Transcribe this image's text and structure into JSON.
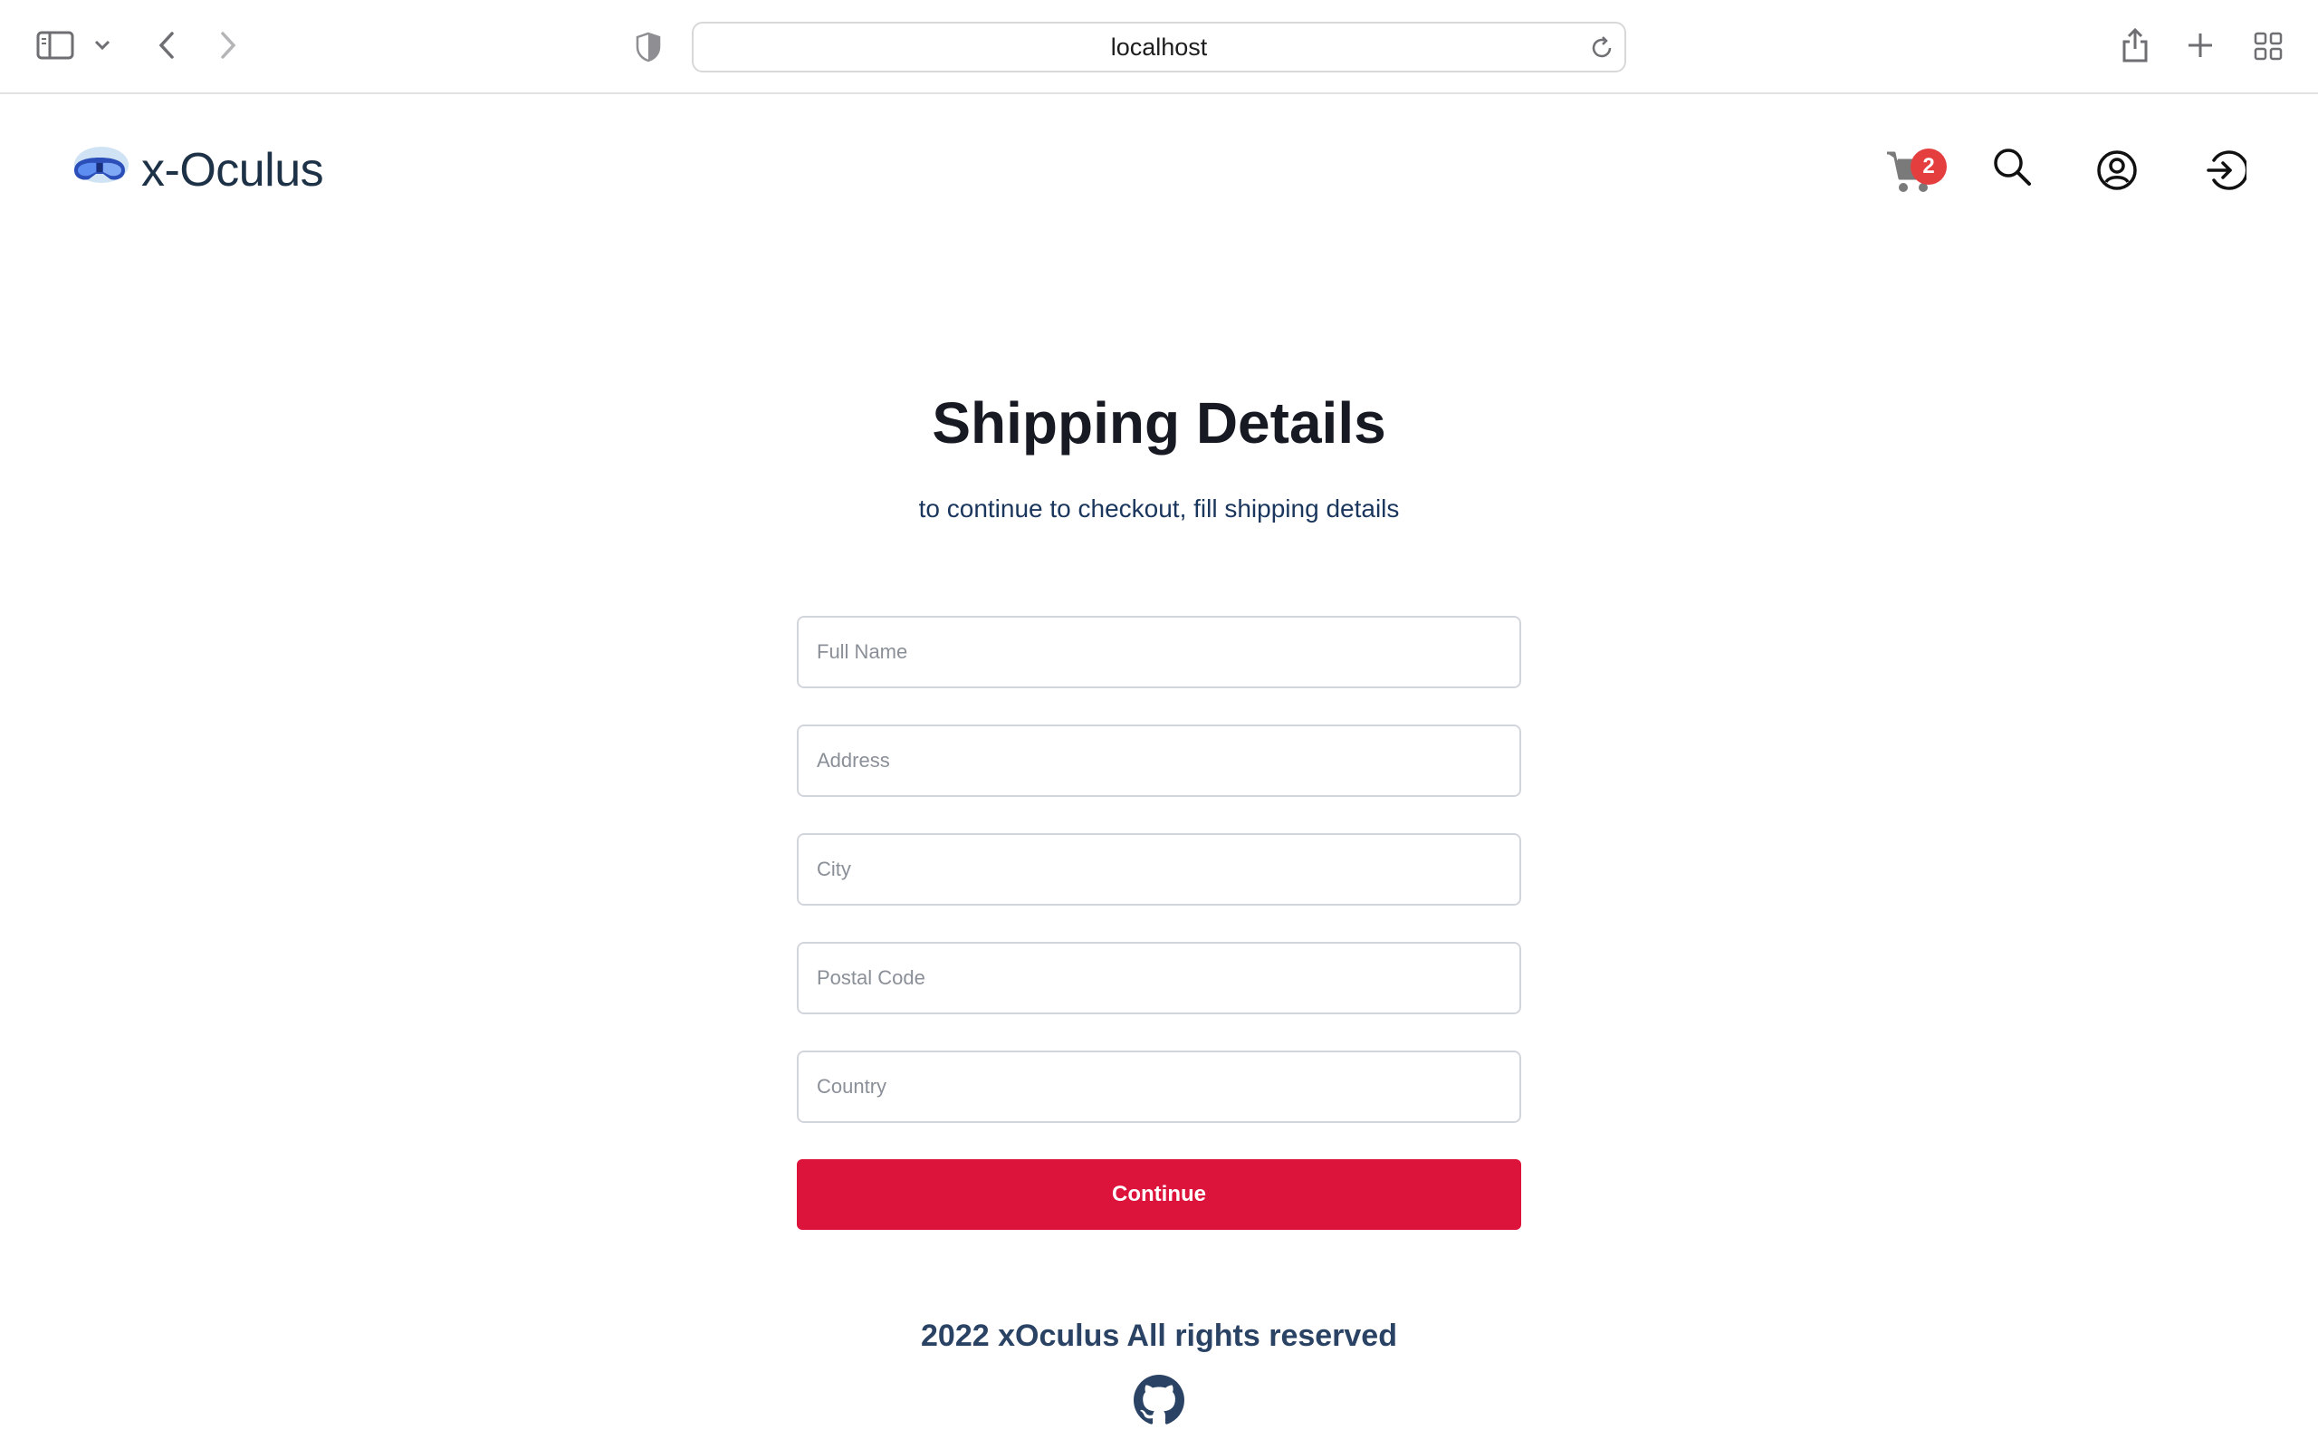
{
  "browser": {
    "url": "localhost",
    "icons": [
      "sidebar-icon",
      "chevron-down-icon",
      "back-icon",
      "forward-icon",
      "shield-icon",
      "reload-icon",
      "share-icon",
      "plus-icon",
      "tab-grid-icon"
    ]
  },
  "header": {
    "logo_text": "x-Oculus",
    "cart_count": "2",
    "icons": [
      "vr-headset-logo-icon",
      "cart-icon",
      "search-icon",
      "user-circle-icon",
      "sign-in-icon"
    ]
  },
  "main": {
    "title": "Shipping Details",
    "subtitle": "to continue to checkout, fill shipping details",
    "fields": {
      "full_name": {
        "placeholder": "Full Name",
        "value": ""
      },
      "address": {
        "placeholder": "Address",
        "value": ""
      },
      "city": {
        "placeholder": "City",
        "value": ""
      },
      "postal_code": {
        "placeholder": "Postal Code",
        "value": ""
      },
      "country": {
        "placeholder": "Country",
        "value": ""
      }
    },
    "continue_label": "Continue"
  },
  "footer": {
    "text": "2022 xOculus All rights reserved",
    "icon": "github-icon"
  },
  "colors": {
    "accent": "#dc143c",
    "badge": "#e53e3e",
    "logo_text": "#1e3247",
    "footer_text": "#2a4365"
  }
}
